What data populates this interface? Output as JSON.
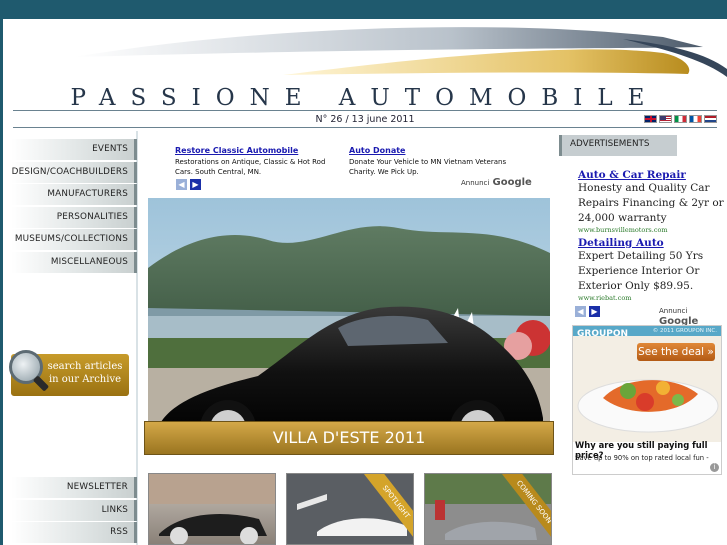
{
  "site": {
    "title": "PASSIONE AUTOMOBILE",
    "issue": "N° 26 / 13 june 2011",
    "flags": [
      "uk-flag",
      "us-flag",
      "italy-flag",
      "france-flag",
      "netherlands-flag"
    ]
  },
  "sidebar": {
    "items": [
      {
        "label": "EVENTS"
      },
      {
        "label": "DESIGN/COACHBUILDERS"
      },
      {
        "label": "MANUFACTURERS"
      },
      {
        "label": "PERSONALITIES"
      },
      {
        "label": "MUSEUMS/COLLECTIONS"
      },
      {
        "label": "MISCELLANEOUS"
      }
    ],
    "archive_label": "search articles in our Archive",
    "bottom_items": [
      {
        "label": "NEWSLETTER"
      },
      {
        "label": "LINKS"
      },
      {
        "label": "RSS"
      }
    ]
  },
  "top_ads": {
    "items": [
      {
        "title": "Restore Classic Automobile",
        "text": "Restorations on Antique, Classic & Hot Rod Cars. South Central, MN."
      },
      {
        "title": "Auto Donate",
        "text": "Donate Your Vehicle to MN Vietnam Veterans Charity. We Pick Up."
      }
    ],
    "brand_prefix": "Annunci",
    "brand": "Google"
  },
  "hero": {
    "caption": "VILLA D'ESTE 2011"
  },
  "thumbs": [
    {
      "ribbon": ""
    },
    {
      "ribbon": "SPOTLIGHT"
    },
    {
      "ribbon": "COMING SOON"
    }
  ],
  "right_ads": {
    "header": "ADVERTISEMENTS",
    "items": [
      {
        "title": "Auto & Car Repair",
        "text": "Honesty and Quality Car Repairs Financing & 2yr or 24,000 warranty",
        "url": "www.burnsvillemotors.com"
      },
      {
        "title": "Detailing Auto",
        "text": "Expert Detailing 50 Yrs Experience Interior Or Exterior Only $89.95.",
        "url": "www.riebat.com"
      }
    ],
    "brand_prefix": "Annunci",
    "brand": "Google"
  },
  "groupon": {
    "logo": "GROUPON",
    "copyright": "© 2011 GROUPON INC.",
    "cta": "See the deal »",
    "question": "Why are you still paying full price?",
    "subline": "Save up to 90% on top rated local fun -",
    "info": "i"
  },
  "colors": {
    "background": "#1f5a6e",
    "gold": "#c79b2a",
    "link_blue": "#1a1ab0"
  }
}
